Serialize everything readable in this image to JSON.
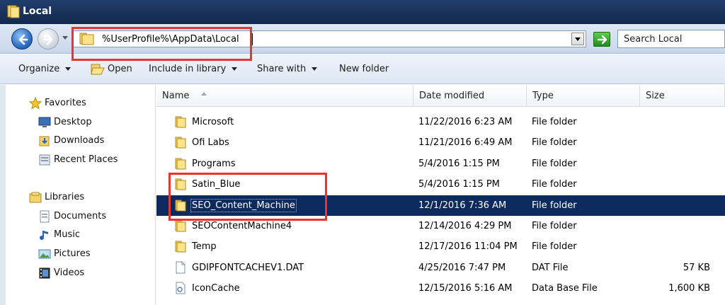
{
  "window": {
    "title": "Local"
  },
  "address": {
    "path": "%UserProfile%\\AppData\\Local"
  },
  "search": {
    "placeholder": "Search Local"
  },
  "toolbar": {
    "organize": "Organize",
    "open": "Open",
    "include": "Include in library",
    "share": "Share with",
    "newfolder": "New folder"
  },
  "nav": {
    "favorites": "Favorites",
    "desktop": "Desktop",
    "downloads": "Downloads",
    "recent": "Recent Places",
    "libraries": "Libraries",
    "documents": "Documents",
    "music": "Music",
    "pictures": "Pictures",
    "videos": "Videos"
  },
  "columns": {
    "name": "Name",
    "date": "Date modified",
    "type": "Type",
    "size": "Size"
  },
  "files": [
    {
      "name": "Microsoft",
      "date": "11/22/2016 6:23 AM",
      "type": "File folder",
      "size": "",
      "icon": "folder-icon"
    },
    {
      "name": "Ofi Labs",
      "date": "11/21/2016 6:49 AM",
      "type": "File folder",
      "size": "",
      "icon": "folder-icon"
    },
    {
      "name": "Programs",
      "date": "5/4/2016 1:15 PM",
      "type": "File folder",
      "size": "",
      "icon": "folder-icon"
    },
    {
      "name": "Satin_Blue",
      "date": "5/4/2016 1:15 PM",
      "type": "File folder",
      "size": "",
      "icon": "folder-icon"
    },
    {
      "name": "SEO_Content_Machine",
      "date": "12/1/2016 7:36 AM",
      "type": "File folder",
      "size": "",
      "icon": "folder-icon",
      "selected": true
    },
    {
      "name": "SEOContentMachine4",
      "date": "12/14/2016 4:29 PM",
      "type": "File folder",
      "size": "",
      "icon": "folder-icon"
    },
    {
      "name": "Temp",
      "date": "12/17/2016 11:04 PM",
      "type": "File folder",
      "size": "",
      "icon": "folder-icon"
    },
    {
      "name": "GDIPFONTCACHEV1.DAT",
      "date": "4/25/2016 7:47 PM",
      "type": "DAT File",
      "size": "57 KB",
      "icon": "file-icon"
    },
    {
      "name": "IconCache",
      "date": "12/15/2016 5:16 AM",
      "type": "Data Base File",
      "size": "1,600 KB",
      "icon": "database-file-icon"
    }
  ],
  "colors": {
    "selection": "#0c2a5d",
    "highlight": "#e8362c",
    "titlebar": "#1a355e"
  }
}
